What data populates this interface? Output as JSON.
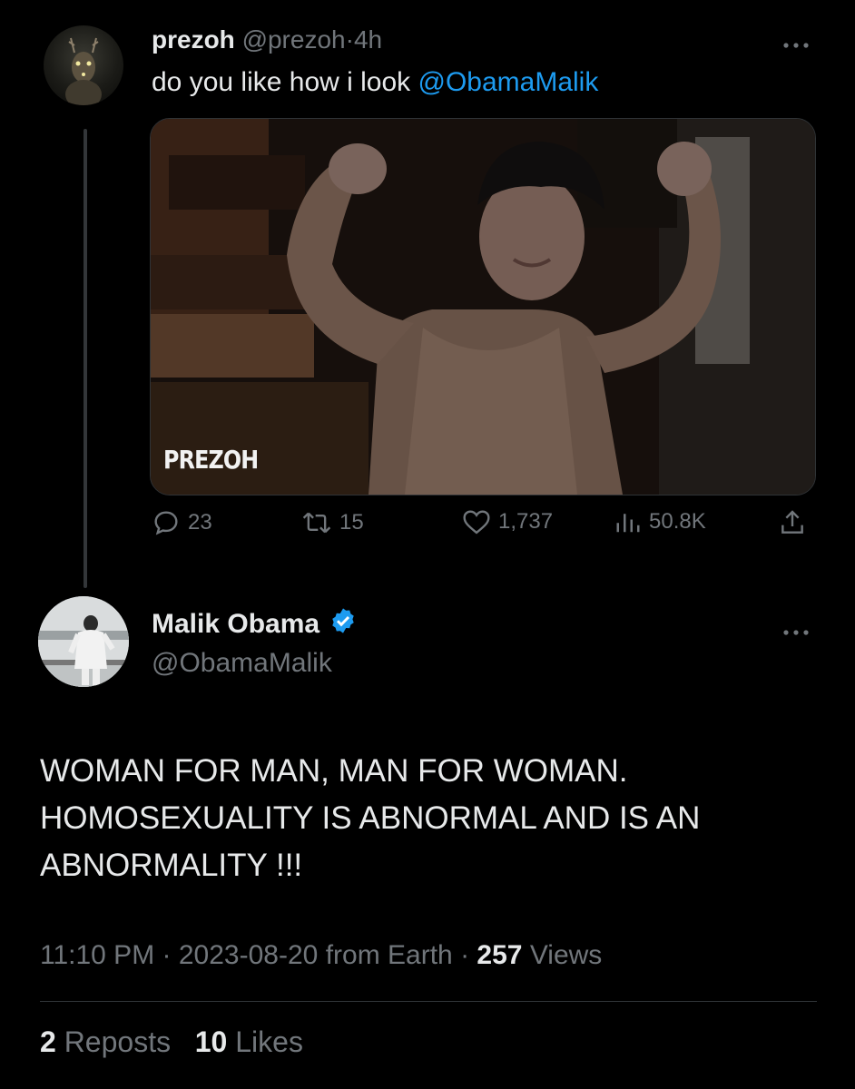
{
  "parent_tweet": {
    "display_name": "prezoh",
    "handle": "@prezoh",
    "separator": "·",
    "time_ago": "4h",
    "text_prefix": "do you like how i look ",
    "mention": "@ObamaMalik",
    "media_watermark": "PREZOH",
    "actions": {
      "replies": "23",
      "reposts": "15",
      "likes": "1,737",
      "views": "50.8K"
    }
  },
  "main_tweet": {
    "display_name": "Malik Obama",
    "handle": "@ObamaMalik",
    "verified": true,
    "text": "WOMAN FOR MAN, MAN FOR WOMAN.\nHOMOSEXUALITY IS ABNORMAL AND IS AN\nABNORMALITY !!!",
    "time": "11:10 PM",
    "date": "2023-08-20",
    "source": "from Earth",
    "separator": "·",
    "views_count": "257",
    "views_label": "Views",
    "reposts_count": "2",
    "reposts_label": "Reposts",
    "likes_count": "10",
    "likes_label": "Likes"
  },
  "colors": {
    "background": "#000000",
    "text": "#e7e9ea",
    "muted": "#71767b",
    "accent": "#1d9bf0",
    "divider": "#2f3336"
  },
  "icons": [
    "more-icon",
    "reply-icon",
    "repost-icon",
    "like-icon",
    "views-icon",
    "share-icon",
    "verified-badge-icon"
  ]
}
